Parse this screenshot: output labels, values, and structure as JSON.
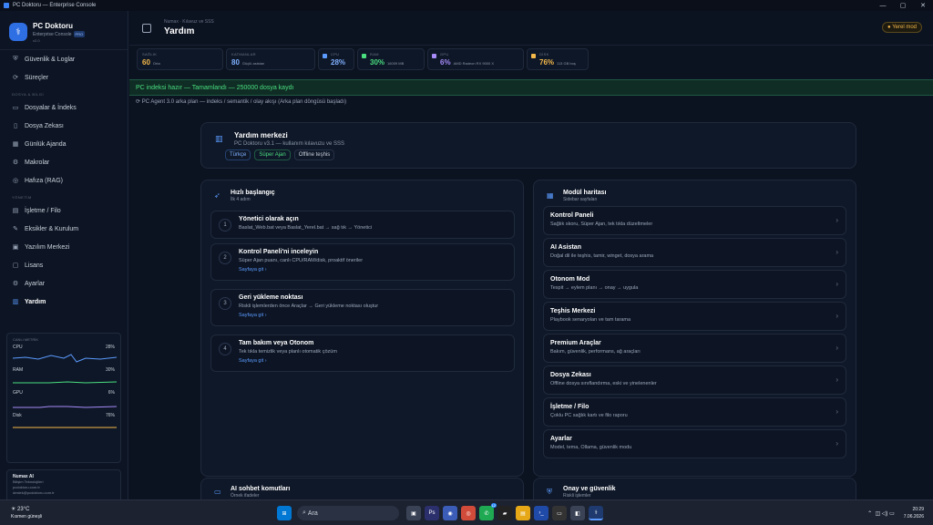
{
  "window": {
    "title": "PC Doktoru — Enterprise Console",
    "controls": [
      "—",
      "▢",
      "✕"
    ]
  },
  "sidebar": {
    "brand": {
      "name": "PC Doktoru",
      "subtitle": "Enterprise Console",
      "badge": "PRO",
      "version": "v2.0"
    },
    "items_top": [
      {
        "label": "Güvenlik & Loglar",
        "icon": "shield-icon"
      },
      {
        "label": "Süreçler",
        "icon": "process-icon"
      }
    ],
    "section_files": "DOSYA & BİLGİ",
    "items_files": [
      {
        "label": "Dosyalar & İndeks",
        "icon": "folder-icon"
      },
      {
        "label": "Dosya Zekası",
        "icon": "file-icon"
      },
      {
        "label": "Günlük Ajanda",
        "icon": "calendar-icon"
      },
      {
        "label": "Makrolar",
        "icon": "macro-icon"
      },
      {
        "label": "Hafıza (RAG)",
        "icon": "memory-icon"
      }
    ],
    "section_admin": "YÖNETİM",
    "items_admin": [
      {
        "label": "İşletme / Filo",
        "icon": "building-icon"
      },
      {
        "label": "Eksikler & Kurulum",
        "icon": "wrench-icon"
      },
      {
        "label": "Yazılım Merkezi",
        "icon": "package-icon"
      },
      {
        "label": "Lisans",
        "icon": "license-icon"
      },
      {
        "label": "Ayarlar",
        "icon": "gear-icon"
      },
      {
        "label": "Yardım",
        "icon": "book-icon"
      }
    ],
    "metrics": {
      "title": "CANLI METRİK",
      "rows": [
        {
          "label": "CPU",
          "value": "28%",
          "color": "#5b9bff"
        },
        {
          "label": "RAM",
          "value": "30%",
          "color": "#4ade80"
        },
        {
          "label": "GPU",
          "value": "6%",
          "color": "#a78bfa"
        },
        {
          "label": "Disk",
          "value": "76%",
          "color": "#f5b94a"
        }
      ]
    },
    "footer": {
      "name": "Numax AI",
      "company": "Bilişim Teknolojileri",
      "site": "pcdoktoru.com.tr",
      "email": "destek@pcdoktoru.com.tr"
    }
  },
  "header": {
    "breadcrumb": "Numax · Kılavuz ve SSS",
    "title": "Yardım",
    "local_mode": "Yerel mod"
  },
  "stats": [
    {
      "label": "SAĞLIK",
      "value": "60",
      "sub": "Orta",
      "color": "#f5b94a",
      "icon_color": "#f5b94a"
    },
    {
      "label": "KATMANLAR",
      "value": "80",
      "sub": "Güçlü asistan",
      "color": "#7fb0ff",
      "icon_color": "#5b9bff"
    },
    {
      "label": "CPU",
      "value": "28%",
      "sub": "",
      "color": "#7fb0ff",
      "icon_color": "#5b9bff"
    },
    {
      "label": "RAM",
      "value": "30%",
      "sub": "16009 MB",
      "color": "#4ade80",
      "icon_color": "#4ade80"
    },
    {
      "label": "GPU",
      "value": "6%",
      "sub": "AMD Radeon RX 9000 X",
      "color": "#a78bfa",
      "icon_color": "#a78bfa"
    },
    {
      "label": "DİSK",
      "value": "76%",
      "sub": "113 GB boş",
      "color": "#f5b94a",
      "icon_color": "#f5b94a"
    }
  ],
  "banner": "PC indeksi hazır — Tamamlandı — 250000 dosya kaydı",
  "agent_status": "PC Agent 3.0 arka plan — indeks / semantik / olay akışı (Arka plan döngüsü başladı)",
  "help": {
    "title": "Yardım merkezi",
    "subtitle": "PC Doktoru v3.1 — kullanım kılavuzu ve SSS",
    "chips": [
      "Türkçe",
      "Süper Ajan",
      "Offline teşhis"
    ]
  },
  "quick_start": {
    "title": "Hızlı başlangıç",
    "subtitle": "İlk 4 adım",
    "steps": [
      {
        "num": "1",
        "title": "Yönetici olarak açın",
        "desc": "Baslat_Web.bat veya Baslat_Yerel.bat → sağ tık → Yönetici",
        "link": ""
      },
      {
        "num": "2",
        "title": "Kontrol Paneli'ni inceleyin",
        "desc": "Süper Ajan puanı, canlı CPU/RAM/disk, proaktif öneriler",
        "link": "Sayfaya git ›"
      },
      {
        "num": "3",
        "title": "Geri yükleme noktası",
        "desc": "Riskli işlemlerden önce Araçlar → Geri yükleme noktası oluştur",
        "link": "Sayfaya git ›"
      },
      {
        "num": "4",
        "title": "Tam bakım veya Otonom",
        "desc": "Tek tıkla temizlik veya planlı otomatik çözüm",
        "link": "Sayfaya git ›"
      }
    ]
  },
  "module_map": {
    "title": "Modül haritası",
    "subtitle": "Sidebar sayfaları",
    "modules": [
      {
        "title": "Kontrol Paneli",
        "desc": "Sağlık skoru, Süper Ajan, tek tıkla düzeltmeler"
      },
      {
        "title": "AI Asistan",
        "desc": "Doğal dil ile teşhis, tamir, winget, dosya arama"
      },
      {
        "title": "Otonom Mod",
        "desc": "Tespit → eylem planı → onay → uygula"
      },
      {
        "title": "Teşhis Merkezi",
        "desc": "Playbook senaryoları ve tam tarama"
      },
      {
        "title": "Premium Araçlar",
        "desc": "Bakım, güvenlik, performans, ağ araçları"
      },
      {
        "title": "Dosya Zekası",
        "desc": "Offline dosya sınıflandırma, eski ve yinelenenler"
      },
      {
        "title": "İşletme / Filo",
        "desc": "Çoklu PC sağlık kartı ve filo raporu"
      },
      {
        "title": "Ayarlar",
        "desc": "Model, tema, Ollama, güvenlik modu"
      }
    ]
  },
  "bottom_cards": [
    {
      "title": "AI sohbet komutları",
      "subtitle": "Örnek ifadeler"
    },
    {
      "title": "Onay ve güvenlik",
      "subtitle": "Riskli işlemler"
    }
  ],
  "taskbar": {
    "temp": "23°C",
    "weather": "Kısmen güneşli",
    "search": "Ara",
    "time": "20:29",
    "date": "7.06.2026",
    "badge": "12"
  }
}
